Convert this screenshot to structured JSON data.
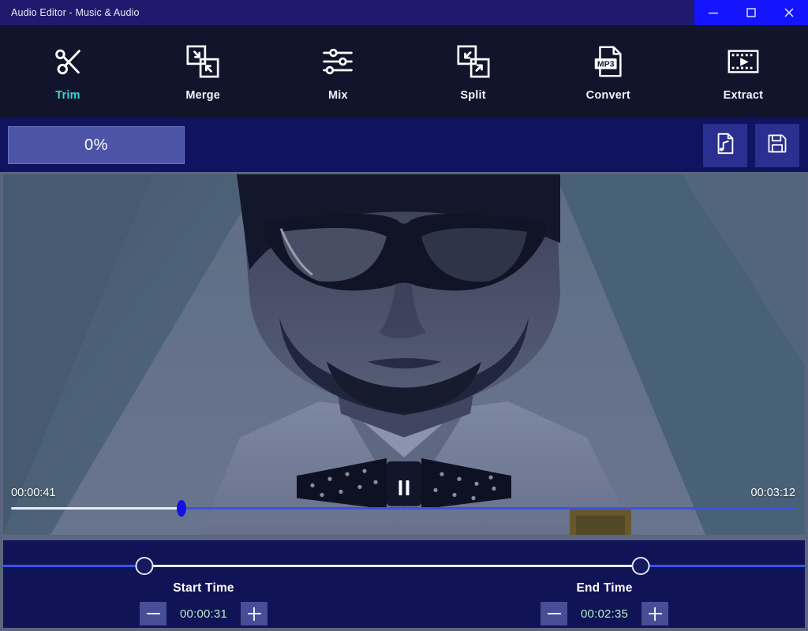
{
  "window": {
    "title": "Audio Editor - Music & Audio",
    "controls": [
      {
        "name": "minimize",
        "glyph": "minimize-icon"
      },
      {
        "name": "maximize",
        "glyph": "maximize-icon"
      },
      {
        "name": "close",
        "glyph": "close-icon"
      }
    ]
  },
  "toolbar": {
    "items": [
      {
        "label": "Trim",
        "icon": "scissors-icon",
        "active": true
      },
      {
        "label": "Merge",
        "icon": "merge-icon",
        "active": false
      },
      {
        "label": "Mix",
        "icon": "sliders-icon",
        "active": false
      },
      {
        "label": "Split",
        "icon": "split-icon",
        "active": false
      },
      {
        "label": "Convert",
        "icon": "mp3-file-icon",
        "active": false
      },
      {
        "label": "Extract",
        "icon": "film-play-icon",
        "active": false
      }
    ]
  },
  "progress": {
    "percent_label": "0%",
    "percent_value": 0,
    "actions": [
      {
        "name": "add-audio",
        "icon": "music-file-icon"
      },
      {
        "name": "save",
        "icon": "floppy-save-icon"
      }
    ]
  },
  "player": {
    "current_time": "00:00:41",
    "total_time": "00:03:12",
    "playhead_percent": 21.5,
    "transport_icon": "pause-icon",
    "state": "playing"
  },
  "trim": {
    "start_handle_percent": 17.6,
    "end_handle_percent": 79.5,
    "start": {
      "label": "Start Time",
      "value": "00:00:31",
      "decrease_icon": "minus-icon",
      "increase_icon": "plus-icon"
    },
    "end": {
      "label": "End Time",
      "value": "00:02:35",
      "decrease_icon": "minus-icon",
      "increase_icon": "plus-icon"
    }
  },
  "colors": {
    "titlebar": "#201a6e",
    "window_controls_bg": "#1414ff",
    "toolbar_bg": "#12142b",
    "accent_active": "#3fd4d8",
    "progress_strip_bg": "#101360",
    "progress_fill": "#4d53a6",
    "panel_bg": "#101356",
    "panel_border": "#5b6580",
    "slider_blue": "#3a52e8",
    "slider_white": "#e6ecf8",
    "time_value": "#b9eec8",
    "playhead": "#1212e0"
  }
}
